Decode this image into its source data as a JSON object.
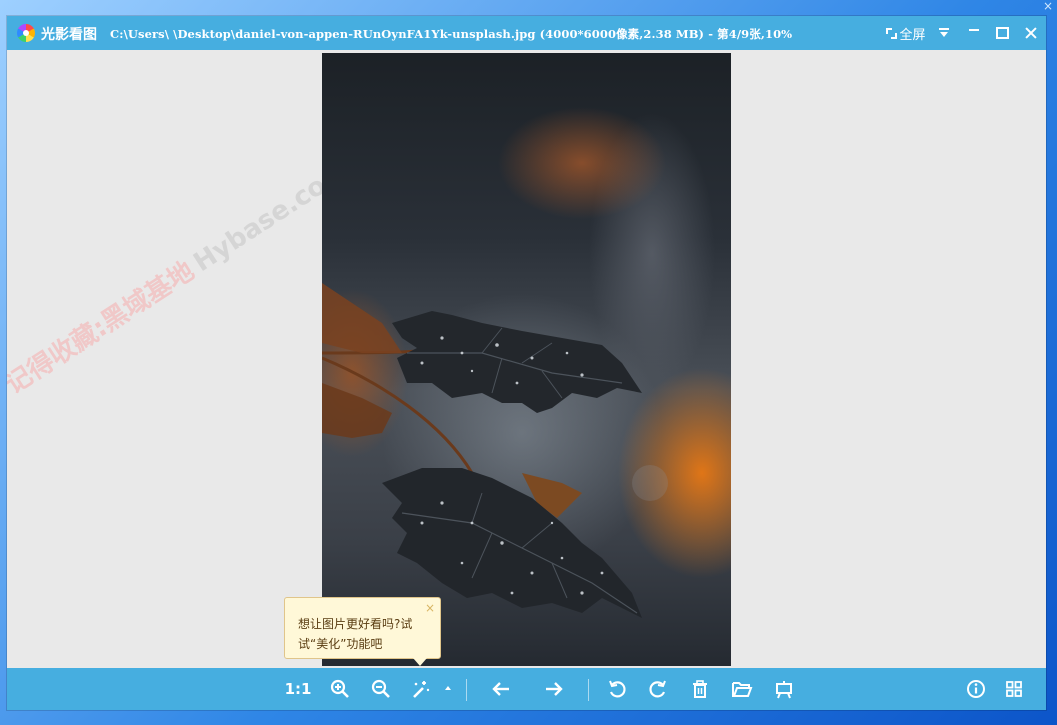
{
  "app": {
    "name": "光影看图",
    "title_path": "C:\\Users\\         \\Desktop\\daniel-von-appen-RUnOynFA1Yk-unsplash.jpg (4000*6000像素,2.38 MB) - 第4/9张,10%"
  },
  "titlebar": {
    "fullscreen_label": "全屏",
    "icons": [
      "fullscreen-icon",
      "dropdown-menu-icon",
      "minimize-icon",
      "maximize-icon",
      "close-icon"
    ]
  },
  "desktop": {
    "corner_close": "×"
  },
  "watermark": {
    "line1": "记得收藏:黑域基地",
    "line2": "Hybase.com"
  },
  "tip": {
    "text_line1": "想让图片更好看吗?试",
    "text_line2": "试“美化”功能吧",
    "close": "×"
  },
  "toolbar": {
    "actual_size_label": "1:1",
    "tools": [
      "actual-size",
      "zoom-in-icon",
      "zoom-out-icon",
      "beautify-wand-icon",
      "previous-arrow-icon",
      "next-arrow-icon",
      "rotate-left-icon",
      "rotate-right-icon",
      "delete-trash-icon",
      "open-folder-icon",
      "set-wallpaper-icon",
      "info-icon",
      "grid-view-icon"
    ]
  },
  "colors": {
    "titlebar": "#46aee0",
    "viewer_bg": "#e9e9e9",
    "tip_bg": "#fff8d8",
    "desktop": "#2f86e6"
  }
}
